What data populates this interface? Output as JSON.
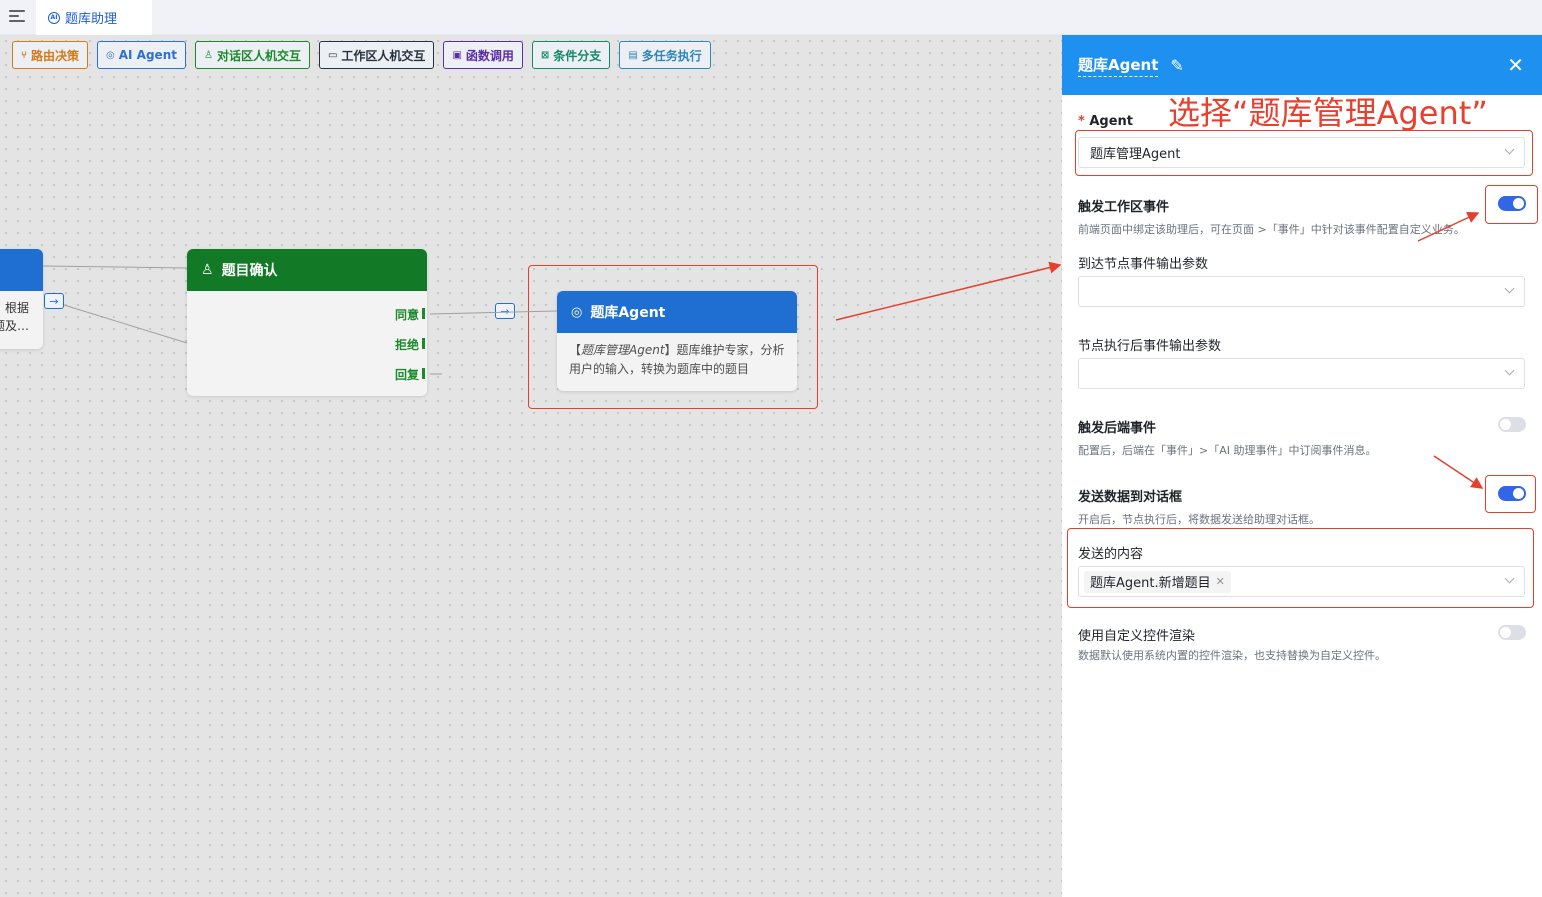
{
  "tabbar": {
    "tab_label": "题库助理",
    "tab_icon": "ai-icon"
  },
  "toolbar": {
    "buttons": [
      {
        "label": "路由决策",
        "icon": "branch-icon",
        "color": "#d47a1a"
      },
      {
        "label": "AI Agent",
        "icon": "agent-icon",
        "color": "#2f6fd1"
      },
      {
        "label": "对话区人机交互",
        "icon": "user-chat-icon",
        "color": "#1a8a2a"
      },
      {
        "label": "工作区人机交互",
        "icon": "monitor-icon",
        "color": "#27323f"
      },
      {
        "label": "函数调用",
        "icon": "function-icon",
        "color": "#5b2ea6"
      },
      {
        "label": "条件分支",
        "icon": "condition-icon",
        "color": "#138a6a"
      },
      {
        "label": "多任务执行",
        "icon": "multitask-icon",
        "color": "#2f86b8"
      }
    ]
  },
  "canvas": {
    "left_node": {
      "text_line1": "根据",
      "text_line2": "题及…"
    },
    "confirm_node": {
      "title": "题目确认",
      "ports": [
        "同意",
        "拒绝",
        "回复"
      ]
    },
    "agent_node": {
      "title": "题库Agent",
      "desc_prefix": "【",
      "desc_agent": "题库管理Agent",
      "desc_rest": "】题库维护专家，分析用户的输入，转换为题库中的题目"
    }
  },
  "panel": {
    "title": "题库Agent",
    "annotation": "选择“题库管理Agent”",
    "agent_label": "Agent",
    "agent_required": "*",
    "agent_value": "题库管理Agent",
    "workspace_event": {
      "label": "触发工作区事件",
      "desc": "前端页面中绑定该助理后，可在页面 >「事件」中针对该事件配置自定义业务。",
      "on": true
    },
    "arrive_output_label": "到达节点事件输出参数",
    "after_output_label": "节点执行后事件输出参数",
    "backend_event": {
      "label": "触发后端事件",
      "desc": "配置后，后端在「事件」>「AI 助理事件」中订阅事件消息。",
      "on": false
    },
    "send_to_dialog": {
      "label": "发送数据到对话框",
      "desc": "开启后，节点执行后，将数据发送给助理对话框。",
      "on": true
    },
    "send_content_label": "发送的内容",
    "send_content_tag": "题库Agent.新增题目",
    "custom_render": {
      "label": "使用自定义控件渲染",
      "desc": "数据默认使用系统内置的控件渲染，也支持替换为自定义控件。",
      "on": false
    }
  }
}
